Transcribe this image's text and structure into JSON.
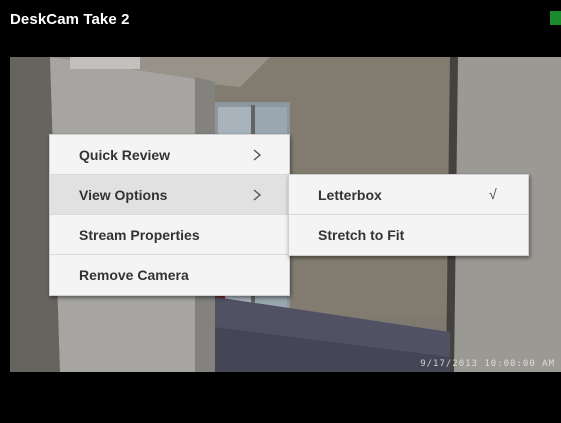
{
  "window": {
    "title": "DeskCam Take 2"
  },
  "video": {
    "timestamp": "9/17/2013 10:00:00 AM"
  },
  "context_menu": {
    "items": [
      {
        "label": "Quick Review",
        "icon": "chevron-right-icon"
      },
      {
        "label": "View Options",
        "icon": "chevron-right-icon"
      },
      {
        "label": "Stream Properties"
      },
      {
        "label": "Remove Camera"
      }
    ]
  },
  "view_options_submenu": {
    "items": [
      {
        "label": "Letterbox",
        "checked": true,
        "check_glyph": "√"
      },
      {
        "label": "Stretch to Fit",
        "checked": false
      }
    ]
  },
  "colors": {
    "status_indicator": "#1a8a2a",
    "menu_bg": "#f4f4f4",
    "menu_highlight": "#e1e1e1",
    "menu_text": "#333333"
  }
}
